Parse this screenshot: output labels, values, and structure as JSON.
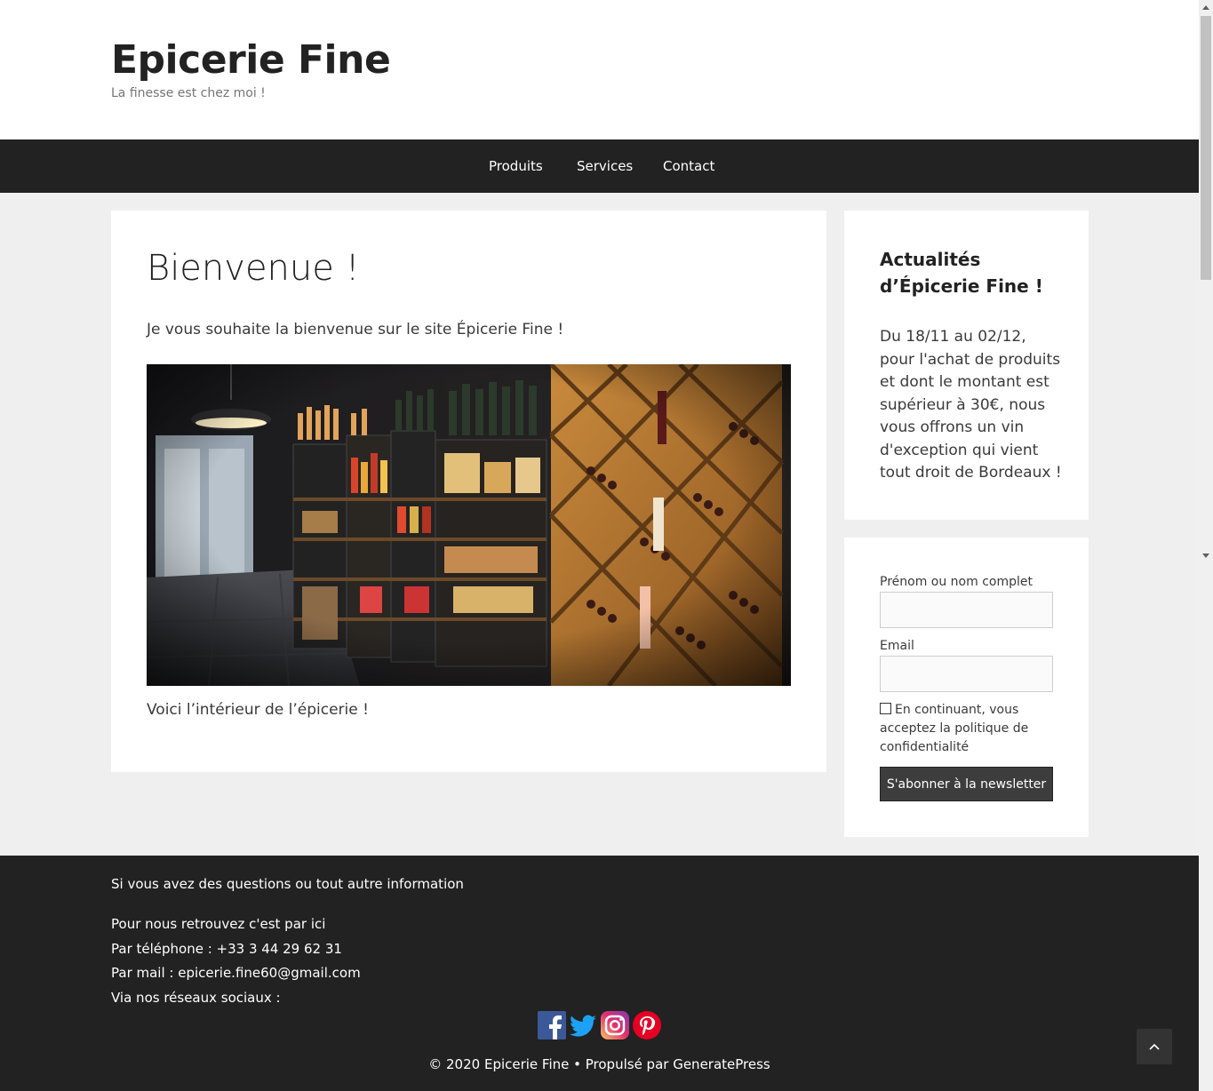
{
  "header": {
    "title": "Epicerie Fine",
    "tagline": "La finesse est chez moi !"
  },
  "nav": {
    "items": [
      {
        "label": "Produits"
      },
      {
        "label": "Services"
      },
      {
        "label": "Contact"
      }
    ]
  },
  "main": {
    "heading": "Bienvenue !",
    "welcome": "Je vous souhaite la bienvenue sur le site Épicerie Fine !",
    "caption": "Voici l’intérieur de l’épicerie !"
  },
  "news_widget": {
    "title": "Actualités d’Épicerie Fine !",
    "body": "Du 18/11 au 02/12, pour l'achat de produits et dont le montant est supérieur à 30€, nous vous offrons un vin d'exception qui vient tout droit de Bordeaux !"
  },
  "newsletter": {
    "name_label": "Prénom ou nom complet",
    "name_value": "",
    "email_label": "Email",
    "email_value": "",
    "consent_checked": false,
    "consent_text": "En continuant, vous acceptez la politique de confidentialité",
    "button_label": "S'abonner à la newsletter"
  },
  "footer": {
    "intro": "Si vous avez des questions ou tout autre information",
    "line1": "Pour nous retrouvez c'est par ici",
    "phone": "Par téléphone : +33 3 44 29 62 31",
    "mail": "Par mail : epicerie.fine60@gmail.com",
    "social_intro": "Via nos réseaux sociaux :",
    "social_icons": [
      "facebook-icon",
      "twitter-icon",
      "instagram-icon",
      "pinterest-icon"
    ],
    "copyright": "© 2020 Epicerie Fine • Propulsé par GeneratePress"
  },
  "colors": {
    "header_bg": "#ffffff",
    "nav_bg": "#222222",
    "page_bg": "#efefef",
    "footer_bg": "#222222",
    "button_bg": "#3d3d3d",
    "facebook": "#3b5998",
    "twitter": "#1da1f2",
    "pinterest": "#e60023"
  }
}
